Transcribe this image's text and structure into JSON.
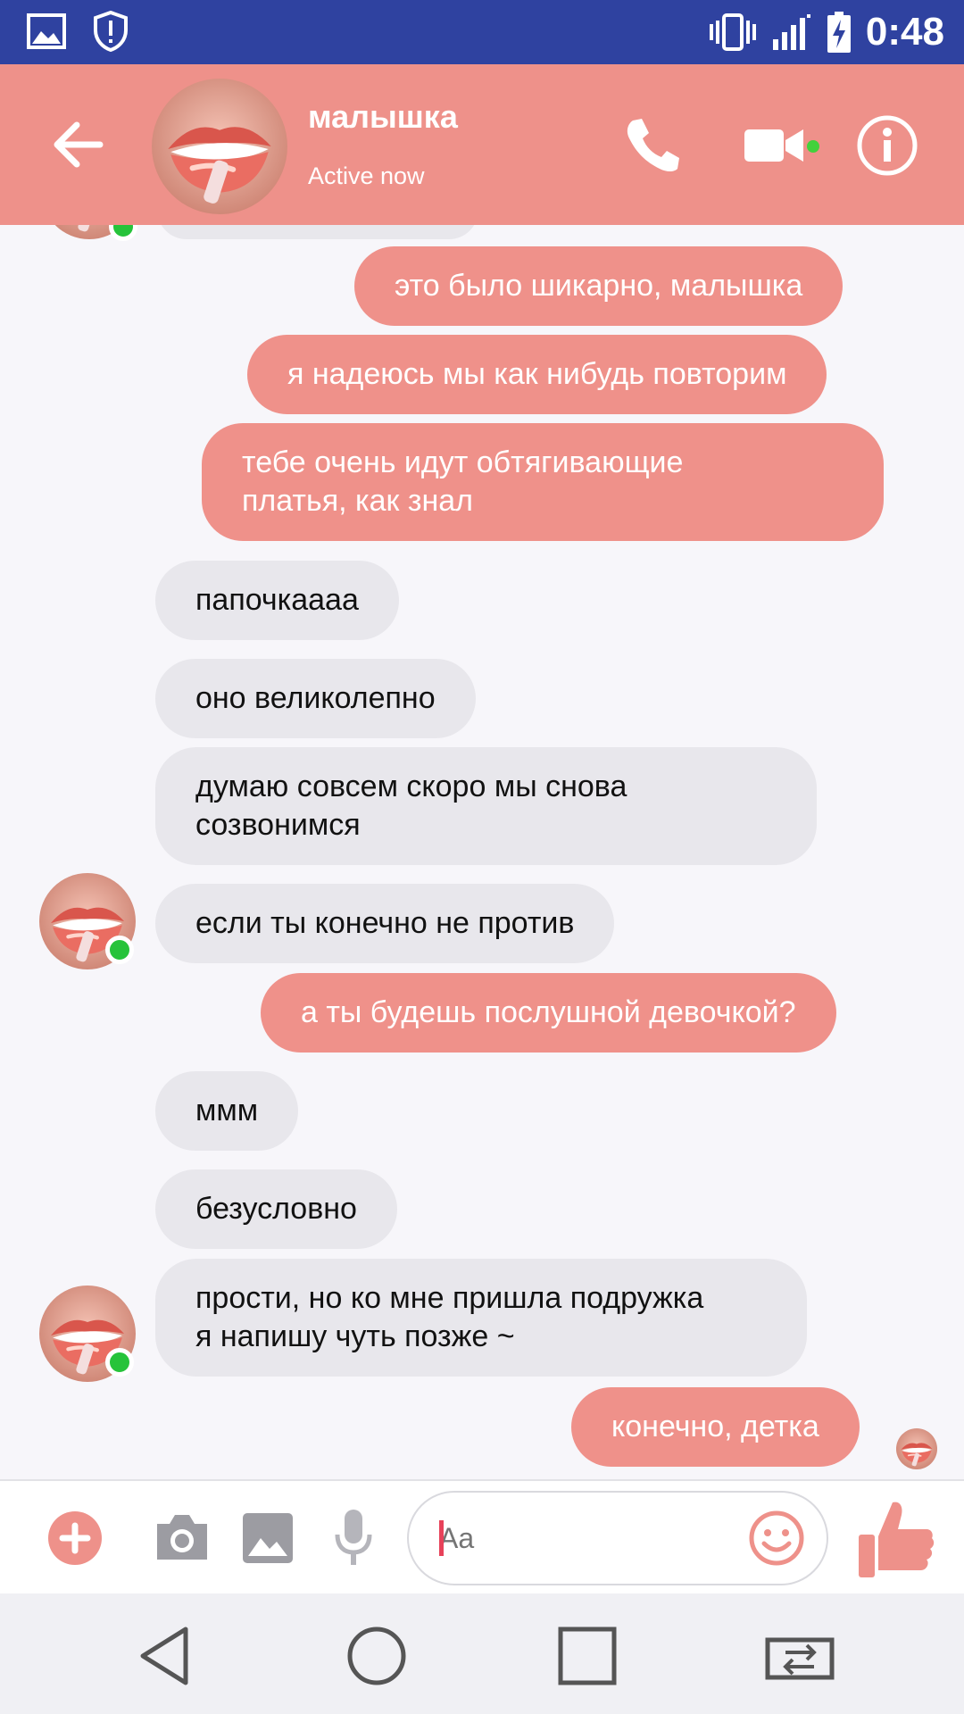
{
  "status_bar": {
    "time": "0:48"
  },
  "header": {
    "back_icon": "back-arrow-icon",
    "contact_name": "малышка",
    "status": "Active now",
    "call_icon": "phone-icon",
    "video_icon": "video-camera-icon",
    "info_icon": "info-icon"
  },
  "messages": [
    {
      "dir": "out",
      "text": "это было шикарно, малышка"
    },
    {
      "dir": "out",
      "text": "я надеюсь мы как нибудь повторим"
    },
    {
      "dir": "out",
      "text": "тебе очень идут обтягивающие\nплатья, как знал"
    },
    {
      "dir": "in",
      "text": "папочкаааа"
    },
    {
      "dir": "in",
      "text": "оно великолепно"
    },
    {
      "dir": "in",
      "text": "думаю совсем скоро мы снова\nсозвонимся"
    },
    {
      "dir": "in",
      "text": "если ты конечно не против"
    },
    {
      "dir": "out",
      "text": "а ты будешь послушной девочкой?"
    },
    {
      "dir": "in",
      "text": "ммм"
    },
    {
      "dir": "in",
      "text": "безусловно"
    },
    {
      "dir": "in",
      "text": "прости, но ко мне пришла подружка\nя напишу чуть позже ~"
    },
    {
      "dir": "out",
      "text": "конечно, детка"
    }
  ],
  "composer": {
    "placeholder": "Aa",
    "icons": [
      "plus-icon",
      "camera-icon",
      "gallery-icon",
      "microphone-icon",
      "emoji-icon",
      "thumbs-up-icon"
    ]
  },
  "nav": {
    "icons": [
      "nav-back-icon",
      "nav-home-icon",
      "nav-recents-icon",
      "screen-switch-icon"
    ]
  },
  "colors": {
    "status_bar": "#2f42a0",
    "header": "#ee918a",
    "outgoing": "#ef918a",
    "incoming": "#e8e7ec",
    "online": "#26c33a"
  }
}
